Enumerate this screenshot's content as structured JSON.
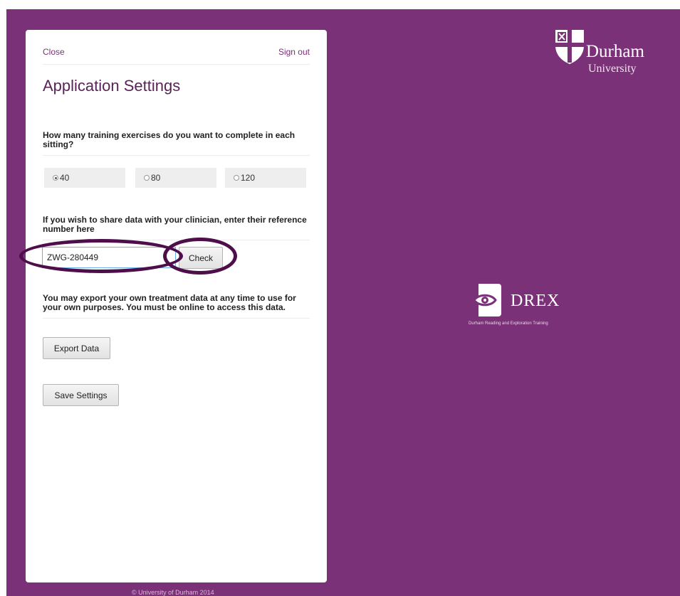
{
  "header": {
    "close_label": "Close",
    "signout_label": "Sign out"
  },
  "page_title": "Application Settings",
  "exercises": {
    "question": "How many training exercises do you want to complete in each sitting?",
    "options": [
      "40",
      "80",
      "120"
    ],
    "selected": "40"
  },
  "clinician": {
    "question": "If you wish to share data with your clinician, enter their reference number here",
    "reference_value": "ZWG-280449",
    "check_label": "Check"
  },
  "export": {
    "text": "You may export your own treatment data at any time to use for your own purposes. You must be online to access this data.",
    "button_label": "Export Data"
  },
  "save_label": "Save Settings",
  "footer": "© University of Durham 2014",
  "branding": {
    "university_name": "Durham",
    "university_sub": "University",
    "app_name": "DREX",
    "app_full_name": "Durham Reading and Exploration Training"
  },
  "icons": [
    "durham-shield-icon",
    "eye-icon"
  ],
  "colors": {
    "brand_purple": "#7b3178",
    "highlight_ring": "#4d0e4a"
  }
}
